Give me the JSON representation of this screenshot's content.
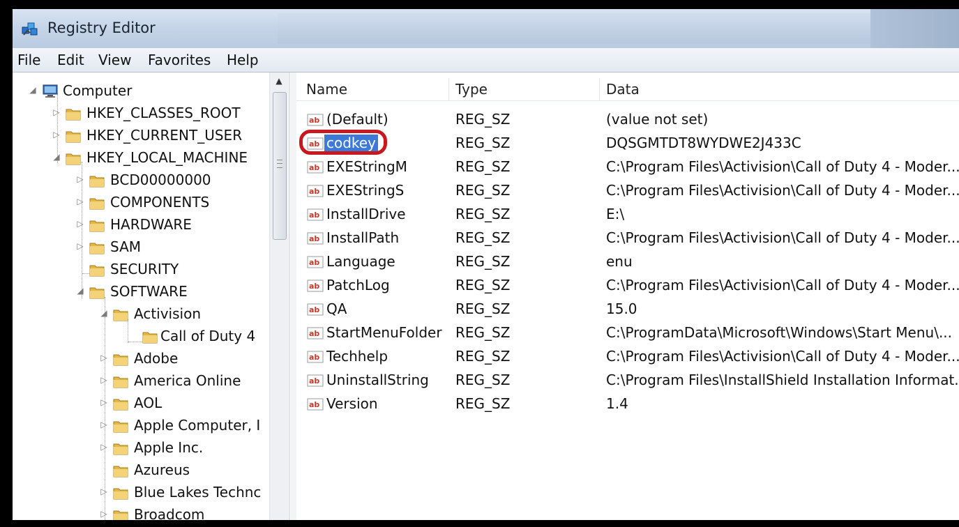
{
  "window": {
    "title": "Registry Editor"
  },
  "menu": [
    "File",
    "Edit",
    "View",
    "Favorites",
    "Help"
  ],
  "tree": {
    "root": "Computer",
    "hives": [
      "HKEY_CLASSES_ROOT",
      "HKEY_CURRENT_USER",
      "HKEY_LOCAL_MACHINE"
    ],
    "hklm_children": [
      "BCD00000000",
      "COMPONENTS",
      "HARDWARE",
      "SAM",
      "SECURITY",
      "SOFTWARE"
    ],
    "software_children": [
      "Activision",
      "Adobe",
      "America Online",
      "AOL",
      "Apple Computer, I",
      "Apple Inc.",
      "Azureus",
      "Blue Lakes Technc",
      "Broadcom"
    ],
    "activision_children": [
      "Call of Duty 4"
    ]
  },
  "columns": {
    "name": "Name",
    "type": "Type",
    "data": "Data"
  },
  "values": [
    {
      "name": "(Default)",
      "type": "REG_SZ",
      "data": "(value not set)"
    },
    {
      "name": "codkey",
      "type": "REG_SZ",
      "data": "DQSGMTDT8WYDWE2J433C"
    },
    {
      "name": "EXEStringM",
      "type": "REG_SZ",
      "data": "C:\\Program Files\\Activision\\Call of Duty 4 - Moder..."
    },
    {
      "name": "EXEStringS",
      "type": "REG_SZ",
      "data": "C:\\Program Files\\Activision\\Call of Duty 4 - Moder..."
    },
    {
      "name": "InstallDrive",
      "type": "REG_SZ",
      "data": "E:\\"
    },
    {
      "name": "InstallPath",
      "type": "REG_SZ",
      "data": "C:\\Program Files\\Activision\\Call of Duty 4 - Moder..."
    },
    {
      "name": "Language",
      "type": "REG_SZ",
      "data": "enu"
    },
    {
      "name": "PatchLog",
      "type": "REG_SZ",
      "data": "C:\\Program Files\\Activision\\Call of Duty 4 - Moder..."
    },
    {
      "name": "QA",
      "type": "REG_SZ",
      "data": "15.0"
    },
    {
      "name": "StartMenuFolder",
      "type": "REG_SZ",
      "data": "C:\\ProgramData\\Microsoft\\Windows\\Start Menu\\..."
    },
    {
      "name": "Techhelp",
      "type": "REG_SZ",
      "data": "C:\\Program Files\\Activision\\Call of Duty 4 - Moder..."
    },
    {
      "name": "UninstallString",
      "type": "REG_SZ",
      "data": "C:\\Program Files\\InstallShield Installation Informat..."
    },
    {
      "name": "Version",
      "type": "REG_SZ",
      "data": "1.4"
    }
  ],
  "selected_value": "codkey",
  "icons": {
    "app": "registry-editor-icon",
    "key": "folder-icon",
    "value": "string-value-icon",
    "root": "computer-icon"
  },
  "colors": {
    "selection": "#3d7ad7",
    "highlight_ring": "#c8171d"
  }
}
